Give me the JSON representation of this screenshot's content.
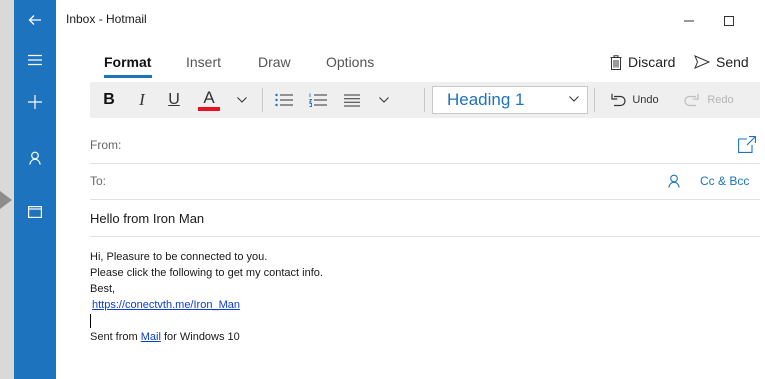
{
  "window": {
    "title": "Inbox - Hotmail"
  },
  "rail": {
    "items": [
      {
        "icon": "back-arrow-icon"
      },
      {
        "icon": "hamburger-icon"
      },
      {
        "icon": "plus-icon"
      },
      {
        "icon": "person-icon"
      },
      {
        "icon": "folder-icon"
      }
    ],
    "color": "#1e73be"
  },
  "tabs": [
    {
      "label": "Format",
      "active": true
    },
    {
      "label": "Insert"
    },
    {
      "label": "Draw"
    },
    {
      "label": "Options"
    }
  ],
  "commands": {
    "discard": "Discard",
    "send": "Send"
  },
  "toolbar": {
    "bold": "B",
    "italic": "I",
    "underline": "U",
    "font_color": "A",
    "font_color_swatch": "#e81123",
    "heading_value": "Heading 1",
    "undo": "Undo",
    "redo": "Redo"
  },
  "compose": {
    "from_label": "From:",
    "to_label": "To:",
    "cc_bcc": "Cc & Bcc",
    "subject": "Hello from Iron Man"
  },
  "message": {
    "line1": "Hi, Pleasure to be connected to you.",
    "line2": "Please click the following to get my contact info.",
    "line3": "Best,",
    "link": "https://conectvth.me/Iron_Man",
    "signature_prefix": "Sent from ",
    "signature_link": "Mail",
    "signature_suffix": " for Windows 10"
  },
  "accent": "#1e73be"
}
